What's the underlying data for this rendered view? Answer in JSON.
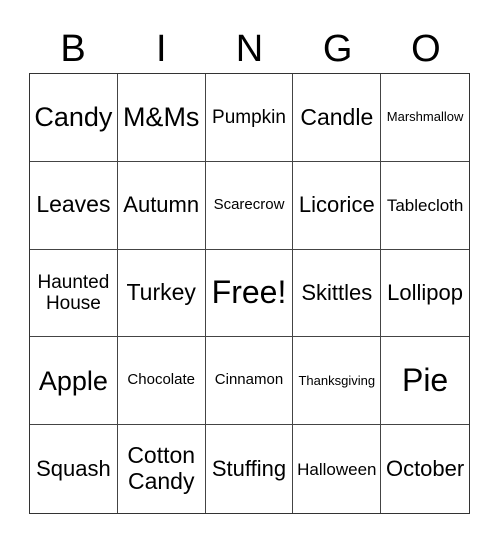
{
  "header": {
    "letters": [
      "B",
      "I",
      "N",
      "G",
      "O"
    ]
  },
  "grid": {
    "rows": [
      [
        "Candy",
        "M&Ms",
        "Pumpkin",
        "Candle",
        "Marshmallow"
      ],
      [
        "Leaves",
        "Autumn",
        "Scarecrow",
        "Licorice",
        "Tablecloth"
      ],
      [
        "Haunted House",
        "Turkey",
        "Free!",
        "Skittles",
        "Lollipop"
      ],
      [
        "Apple",
        "Chocolate",
        "Cinnamon",
        "Thanksgiving",
        "Pie"
      ],
      [
        "Squash",
        "Cotton Candy",
        "Stuffing",
        "Halloween",
        "October"
      ]
    ]
  }
}
